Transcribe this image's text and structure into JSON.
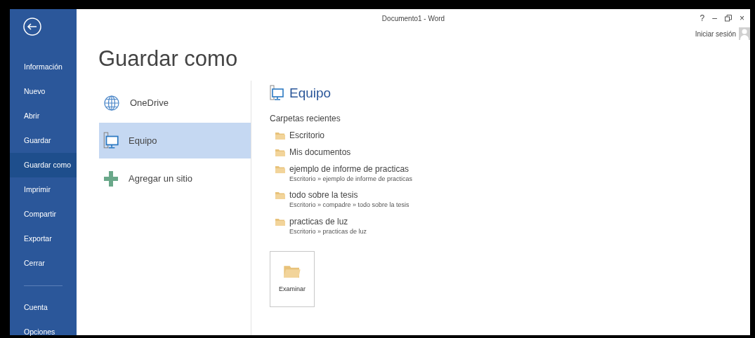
{
  "window": {
    "title": "Documento1 - Word",
    "controls": [
      "?",
      "–",
      "×"
    ],
    "sign_in": "Iniciar sesión"
  },
  "sidebar": {
    "items": [
      {
        "label": "Información",
        "selected": false
      },
      {
        "label": "Nuevo",
        "selected": false
      },
      {
        "label": "Abrir",
        "selected": false
      },
      {
        "label": "Guardar",
        "selected": false
      },
      {
        "label": "Guardar como",
        "selected": true
      },
      {
        "label": "Imprimir",
        "selected": false
      },
      {
        "label": "Compartir",
        "selected": false
      },
      {
        "label": "Exportar",
        "selected": false
      },
      {
        "label": "Cerrar",
        "selected": false
      }
    ],
    "footer_items": [
      {
        "label": "Cuenta",
        "selected": false
      },
      {
        "label": "Opciones",
        "selected": false
      }
    ]
  },
  "heading": "Guardar como",
  "places": [
    {
      "label": "OneDrive",
      "selected": false
    },
    {
      "label": "Equipo",
      "selected": true
    },
    {
      "label": "Agregar un sitio",
      "selected": false
    }
  ],
  "detail": {
    "title": "Equipo",
    "section": "Carpetas recientes",
    "folders": [
      {
        "name": "Escritorio"
      },
      {
        "name": "Mis documentos"
      },
      {
        "name": "ejemplo de informe de practicas",
        "path": "Escritorio » ejemplo de informe de practicas"
      },
      {
        "name": "todo sobre la tesis",
        "path": "Escritorio » compadre » todo sobre la tesis"
      },
      {
        "name": "practicas de luz",
        "path": "Escritorio » practicas de luz"
      }
    ],
    "browse": "Examinar"
  }
}
